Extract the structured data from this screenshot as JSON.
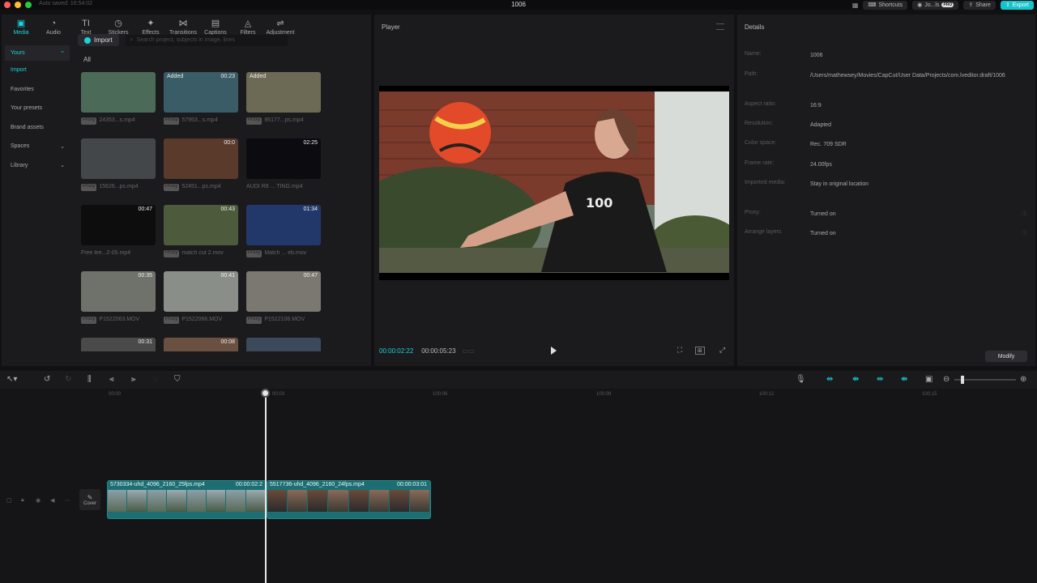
{
  "titlebar": {
    "autosave": "Auto saved: 16:54:02",
    "title": "1006",
    "layout_icon": "layout-icon",
    "shortcuts": "Shortcuts",
    "user": "Jo...ls",
    "pro": "PRO",
    "share": "Share",
    "export": "Export"
  },
  "toolbar": [
    {
      "label": "Media",
      "icon": "▣"
    },
    {
      "label": "Audio",
      "icon": "◔"
    },
    {
      "label": "Text",
      "icon": "TI"
    },
    {
      "label": "Stickers",
      "icon": "◷"
    },
    {
      "label": "Effects",
      "icon": "✦"
    },
    {
      "label": "Transitions",
      "icon": "⋈"
    },
    {
      "label": "Captions",
      "icon": "▤"
    },
    {
      "label": "Filters",
      "icon": "◬"
    },
    {
      "label": "Adjustment",
      "icon": "⇌"
    }
  ],
  "sidebar": {
    "yours": "Yours",
    "import": "Import",
    "favorites": "Favorites",
    "presets": "Your presets",
    "brand": "Brand assets",
    "spaces": "Spaces",
    "library": "Library"
  },
  "media": {
    "import_label": "Import",
    "search_placeholder": "Search project, subjects in image, lines",
    "filter_all": "All",
    "items": [
      {
        "name": "24353...s.mp4",
        "dur": "",
        "added": "",
        "tag": "Proxy",
        "color": "#4b6a58"
      },
      {
        "name": "57953...s.mp4",
        "dur": "00:23",
        "added": "Added",
        "tag": "Proxy",
        "color": "#3a5c66"
      },
      {
        "name": "95177...ps.mp4",
        "dur": "",
        "added": "Added",
        "tag": "Proxy",
        "color": "#6c6a55"
      },
      {
        "name": "15626...ps.mp4",
        "dur": "",
        "added": "",
        "tag": "Proxy",
        "color": "#44474a"
      },
      {
        "name": "52451...ps.mp4",
        "dur": "00:0",
        "added": "",
        "tag": "Proxy",
        "color": "#5a3a2a"
      },
      {
        "name": "AUDI R8 ... TING.mp4",
        "dur": "02:25",
        "added": "",
        "tag": "",
        "color": "#0c0c10"
      },
      {
        "name": "Free lee...2-05.mp4",
        "dur": "00:47",
        "added": "",
        "tag": "",
        "color": "#0c0d0c"
      },
      {
        "name": "match cut 2.mov",
        "dur": "00:43",
        "added": "",
        "tag": "Proxy",
        "color": "#4d5a3c"
      },
      {
        "name": "Match ... eb.mov",
        "dur": "01:34",
        "added": "",
        "tag": "Proxy",
        "color": "#23386a"
      },
      {
        "name": "P1522063.MOV",
        "dur": "00:35",
        "added": "",
        "tag": "Proxy",
        "color": "#6f726a"
      },
      {
        "name": "P1522066.MOV",
        "dur": "00:41",
        "added": "",
        "tag": "Proxy",
        "color": "#8a8e88"
      },
      {
        "name": "P1522106.MOV",
        "dur": "00:47",
        "added": "",
        "tag": "Proxy",
        "color": "#7a7870"
      },
      {
        "name": "",
        "dur": "00:31",
        "added": "",
        "tag": "",
        "color": "#4a4a4a"
      },
      {
        "name": "",
        "dur": "00:08",
        "added": "",
        "tag": "",
        "color": "#6a5040"
      },
      {
        "name": "",
        "dur": "",
        "added": "",
        "tag": "",
        "color": "#3a4a5a"
      }
    ]
  },
  "player": {
    "title": "Player",
    "current": "00:00:02:22",
    "total": "00:00:05:23"
  },
  "details": {
    "title": "Details",
    "rows": [
      {
        "label": "Name:",
        "value": "1006"
      },
      {
        "label": "Path:",
        "value": "/Users/mathewsey/Movies/CapCut/User Data/Projects/com.lveditor.draft/1006"
      },
      {
        "label": "Aspect ratio:",
        "value": "16:9"
      },
      {
        "label": "Resolution:",
        "value": "Adapted"
      },
      {
        "label": "Color space:",
        "value": "Rec. 709 SDR"
      },
      {
        "label": "Frame rate:",
        "value": "24.00fps"
      },
      {
        "label": "Imported media:",
        "value": "Stay in original location"
      },
      {
        "label": "Proxy:",
        "value": "Turned on"
      },
      {
        "label": "Arrange layers",
        "value": "Turned on"
      }
    ],
    "modify": "Modify"
  },
  "timeline": {
    "ruler": [
      "00:00",
      "00:03",
      "100:06",
      "100:09",
      "100:12",
      "100:15"
    ],
    "cover": "Cover",
    "clips": [
      {
        "name": "5730334-uhd_4096_2160_25fps.mp4",
        "dur": "00:00:02:2"
      },
      {
        "name": "5517736-uhd_4096_2160_24fps.mp4",
        "dur": "00:00:03:01"
      }
    ]
  }
}
